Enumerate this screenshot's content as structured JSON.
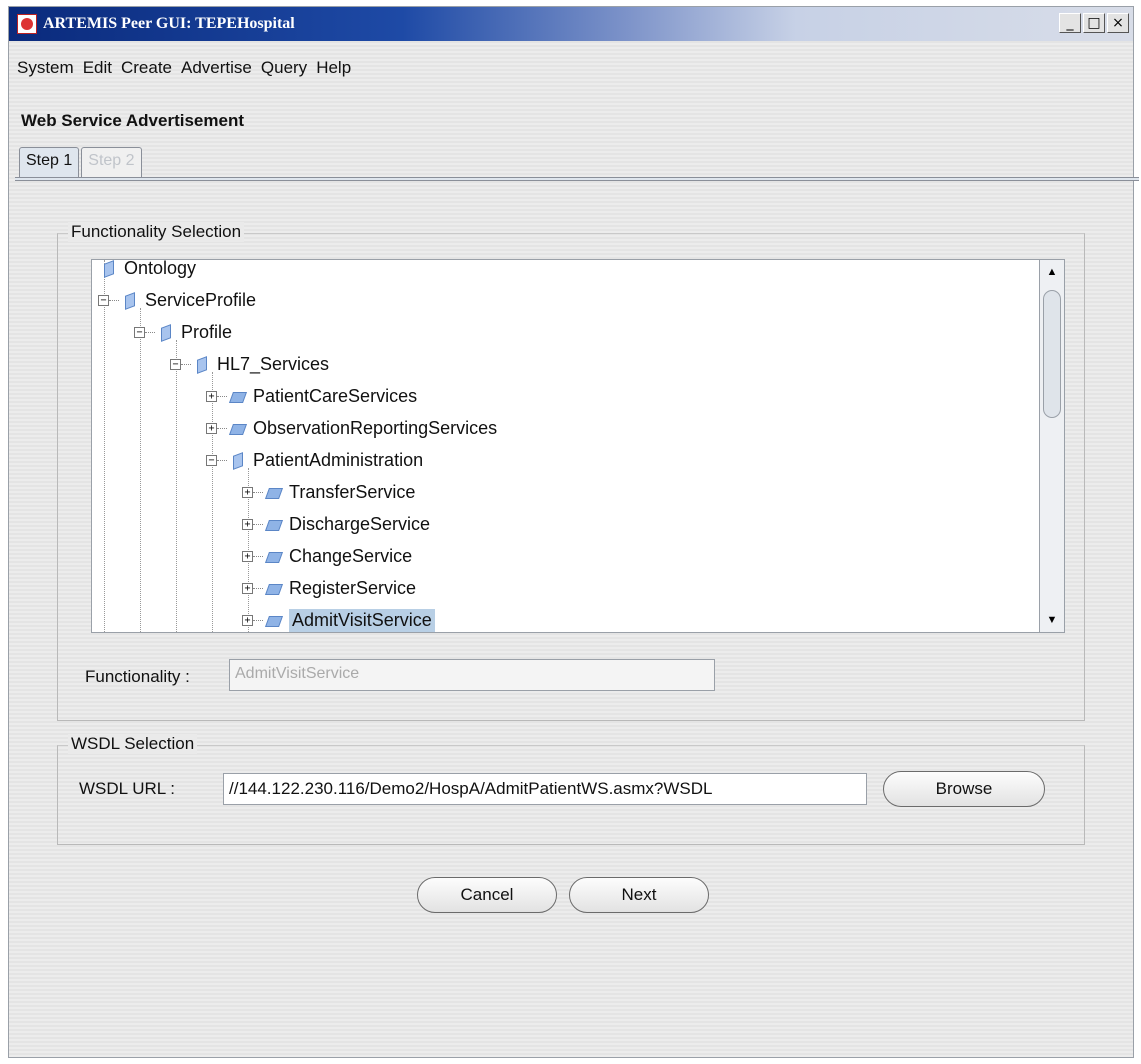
{
  "window": {
    "title": "ARTEMIS Peer GUI: TEPEHospital"
  },
  "menu": [
    "System",
    "Edit",
    "Create",
    "Advertise",
    "Query",
    "Help"
  ],
  "section_title": "Web Service Advertisement",
  "tabs": [
    {
      "label": "Step 1"
    },
    {
      "label": "Step 2"
    }
  ],
  "functionality": {
    "legend": "Functionality Selection",
    "tree": [
      {
        "label": "Ontology"
      },
      {
        "label": "ServiceProfile"
      },
      {
        "label": "Profile"
      },
      {
        "label": "HL7_Services"
      },
      {
        "label": "PatientCareServices"
      },
      {
        "label": "ObservationReportingServices"
      },
      {
        "label": "PatientAdministration"
      },
      {
        "label": "TransferService"
      },
      {
        "label": "DischargeService"
      },
      {
        "label": "ChangeService"
      },
      {
        "label": "RegisterService"
      },
      {
        "label": "AdmitVisitService"
      }
    ],
    "field_label": "Functionality :",
    "field_value": "AdmitVisitService"
  },
  "wsdl": {
    "legend": "WSDL Selection",
    "label": "WSDL URL :",
    "value": "//144.122.230.116/Demo2/HospA/AdmitPatientWS.asmx?WSDL",
    "browse": "Browse"
  },
  "buttons": {
    "cancel": "Cancel",
    "next": "Next"
  }
}
